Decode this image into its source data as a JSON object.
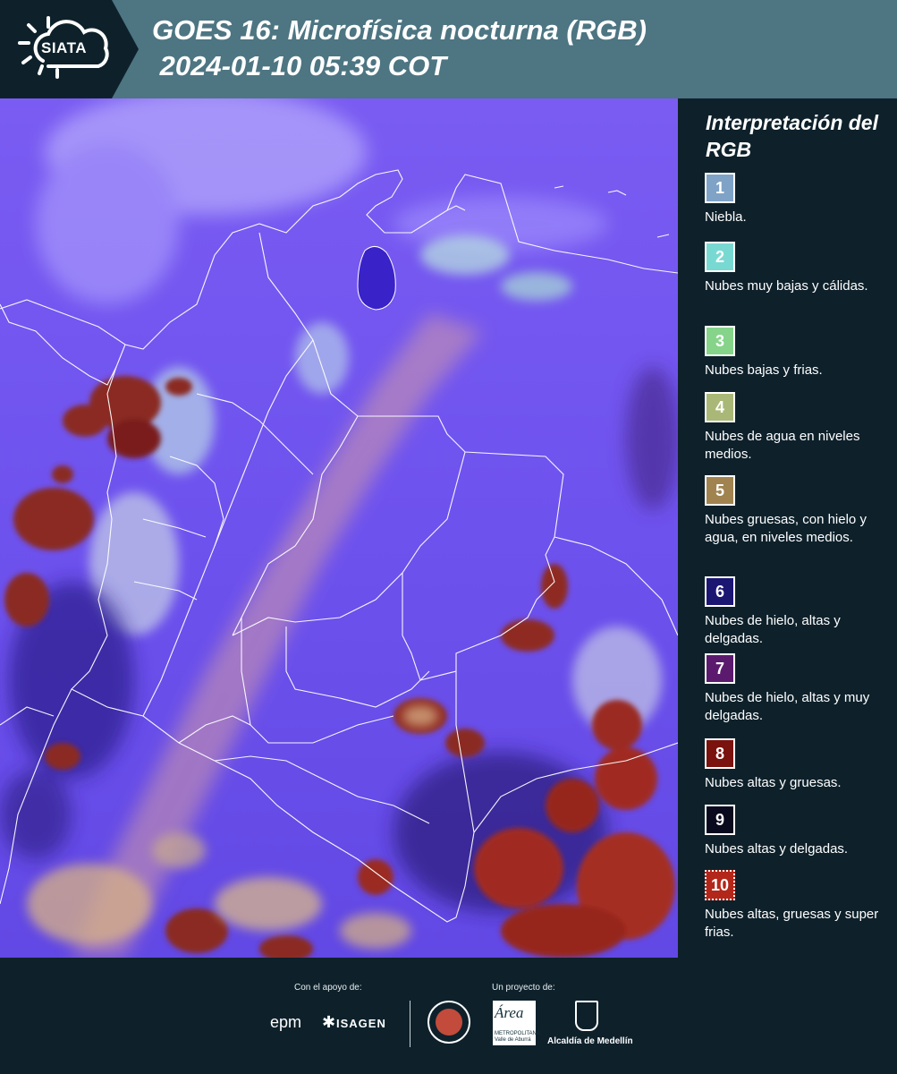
{
  "header": {
    "logo_text": "SIATA",
    "title_line1": "GOES 16: Microfísica nocturna (RGB)",
    "title_line2": " 2024-01-10 05:39 COT",
    "background_color": "#4d7582",
    "logo_band_color": "#0e212b"
  },
  "legend": {
    "title": "Interpretación del RGB",
    "items": [
      {
        "num": "1",
        "label": "Niebla.",
        "color": "#7fa3c7"
      },
      {
        "num": "2",
        "label": "Nubes muy bajas y cálidas.",
        "color": "#78d9d2"
      },
      {
        "num": "3",
        "label": "Nubes bajas y frias.",
        "color": "#85d48a"
      },
      {
        "num": "4",
        "label": "Nubes de agua en niveles medios.",
        "color": "#a9b877"
      },
      {
        "num": "5",
        "label": "Nubes gruesas, con hielo y agua, en niveles medios.",
        "color": "#a0834f"
      },
      {
        "num": "6",
        "label": "Nubes de hielo, altas y delgadas.",
        "color": "#1c1673"
      },
      {
        "num": "7",
        "label": "Nubes de hielo, altas y muy delgadas.",
        "color": "#5c1a6f"
      },
      {
        "num": "8",
        "label": "Nubes altas y gruesas.",
        "color": "#7a120d"
      },
      {
        "num": "9",
        "label": "Nubes altas y delgadas.",
        "color": "#0a0a1e"
      },
      {
        "num": "10",
        "label": "Nubes altas, gruesas y super frias.",
        "color": "#b3271a"
      }
    ]
  },
  "footer": {
    "support_caption": "Con el apoyo de:",
    "project_caption": "Un proyecto de:",
    "sponsor_epm": "epm",
    "sponsor_isagen": "ISAGEN",
    "area_logo_text": "Área",
    "area_logo_sub": "METROPOLITANA Valle de Aburrá",
    "alcaldia_text": "Alcaldía de Medellín"
  }
}
